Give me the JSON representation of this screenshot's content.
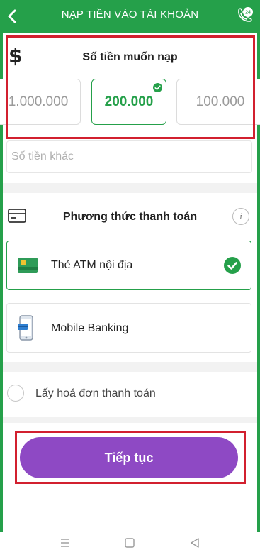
{
  "header": {
    "title": "NẠP TIỀN VÀO TÀI KHOẢN",
    "support_badge": "24",
    "bg_color": "#25a04a"
  },
  "amount_section": {
    "title": "Số tiền muốn nạp",
    "options": [
      {
        "label": "1.000.000",
        "selected": false
      },
      {
        "label": "200.000",
        "selected": true
      },
      {
        "label": "100.000",
        "selected": false
      }
    ],
    "other_amount_placeholder": "Số tiền khác"
  },
  "payment_section": {
    "title": "Phương thức thanh toán",
    "info_icon": "i",
    "methods": [
      {
        "label": "Thẻ ATM nội địa",
        "icon": "atm-card-icon",
        "selected": true
      },
      {
        "label": "Mobile Banking",
        "icon": "mobile-banking-icon",
        "selected": false
      }
    ]
  },
  "invoice": {
    "label": "Lấy hoá đơn thanh toán",
    "checked": false
  },
  "continue_button": {
    "label": "Tiếp tục",
    "color": "#8e49c4"
  },
  "colors": {
    "accent_green": "#25a04a",
    "highlight_red": "#d2202f"
  }
}
